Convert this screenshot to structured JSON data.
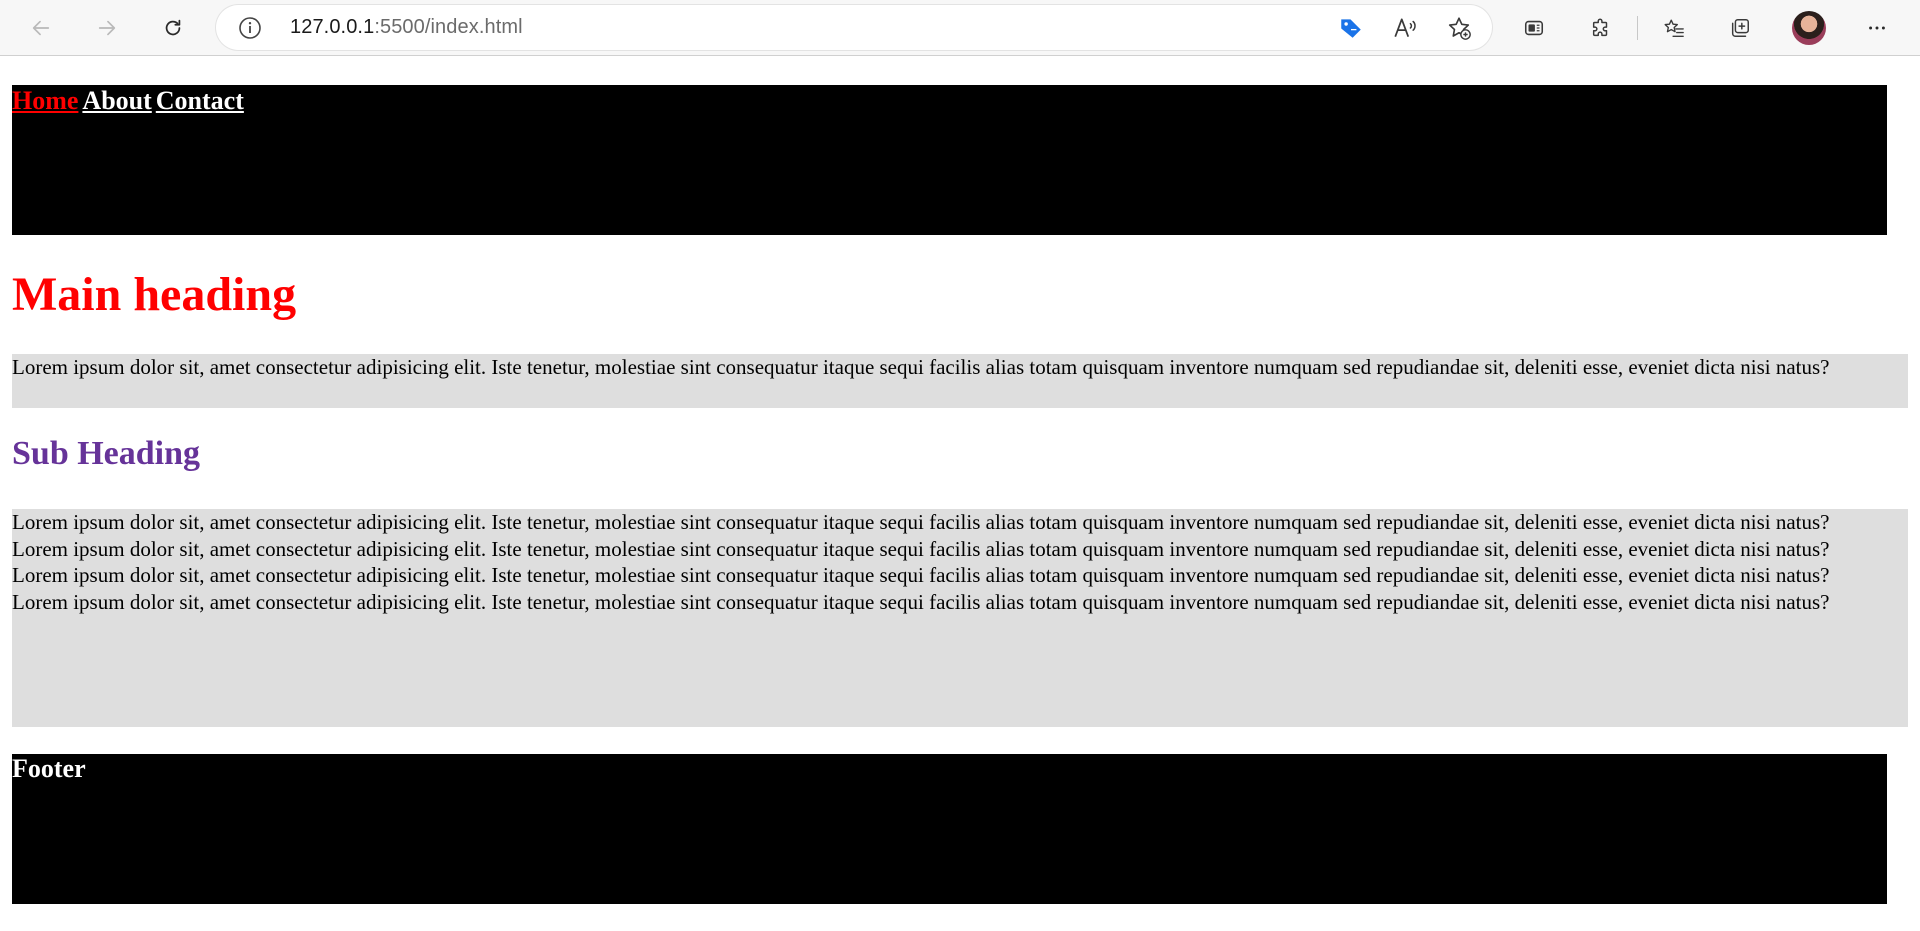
{
  "browser": {
    "url_host": "127.0.0.1",
    "url_rest": ":5500/index.html",
    "icons": {
      "back": "back-arrow-icon",
      "forward": "forward-arrow-icon",
      "refresh": "refresh-icon",
      "info": "info-icon",
      "coupon": "tag-icon",
      "read_aloud": "read-aloud-icon",
      "add_favorite": "star-plus-icon",
      "copilot": "copilot-icon",
      "extensions": "puzzle-icon",
      "favorites": "favorites-icon",
      "collections": "collections-icon",
      "profile": "profile-avatar",
      "menu": "more-icon"
    },
    "accent_color": "#1a73e8"
  },
  "header": {
    "nav": [
      {
        "label": "Home",
        "active": true
      },
      {
        "label": "About",
        "active": false
      },
      {
        "label": "Contact",
        "active": false
      }
    ],
    "background": "#000000",
    "active_color": "#ff0000"
  },
  "main": {
    "heading": "Main heading",
    "paragraph1": "Lorem ipsum dolor sit, amet consectetur adipisicing elit. Iste tenetur, molestiae sint consequatur itaque sequi facilis alias totam quisquam inventore numquam sed repudiandae sit, deleniti esse, eveniet dicta nisi natus?",
    "subheading": "Sub Heading",
    "paragraph2": "Lorem ipsum dolor sit, amet consectetur adipisicing elit. Iste tenetur, molestiae sint consequatur itaque sequi facilis alias totam quisquam inventore numquam sed repudiandae sit, deleniti esse, eveniet dicta nisi natus?Lorem ipsum dolor sit, amet consectetur adipisicing elit. Iste tenetur, molestiae sint consequatur itaque sequi facilis alias totam quisquam inventore numquam sed repudiandae sit, deleniti esse, eveniet dicta nisi natus?Lorem ipsum dolor sit, amet consectetur adipisicing elit. Iste tenetur, molestiae sint consequatur itaque sequi facilis alias totam quisquam inventore numquam sed repudiandae sit, deleniti esse, eveniet dicta nisi natus?Lorem ipsum dolor sit, amet consectetur adipisicing elit. Iste tenetur, molestiae sint consequatur itaque sequi facilis alias totam quisquam inventore numquam sed repudiandae sit, deleniti esse, eveniet dicta nisi natus?",
    "heading_color": "#ff0000",
    "subheading_color": "#663399",
    "paragraph_bg": "#dedede"
  },
  "footer": {
    "title": "Footer"
  }
}
